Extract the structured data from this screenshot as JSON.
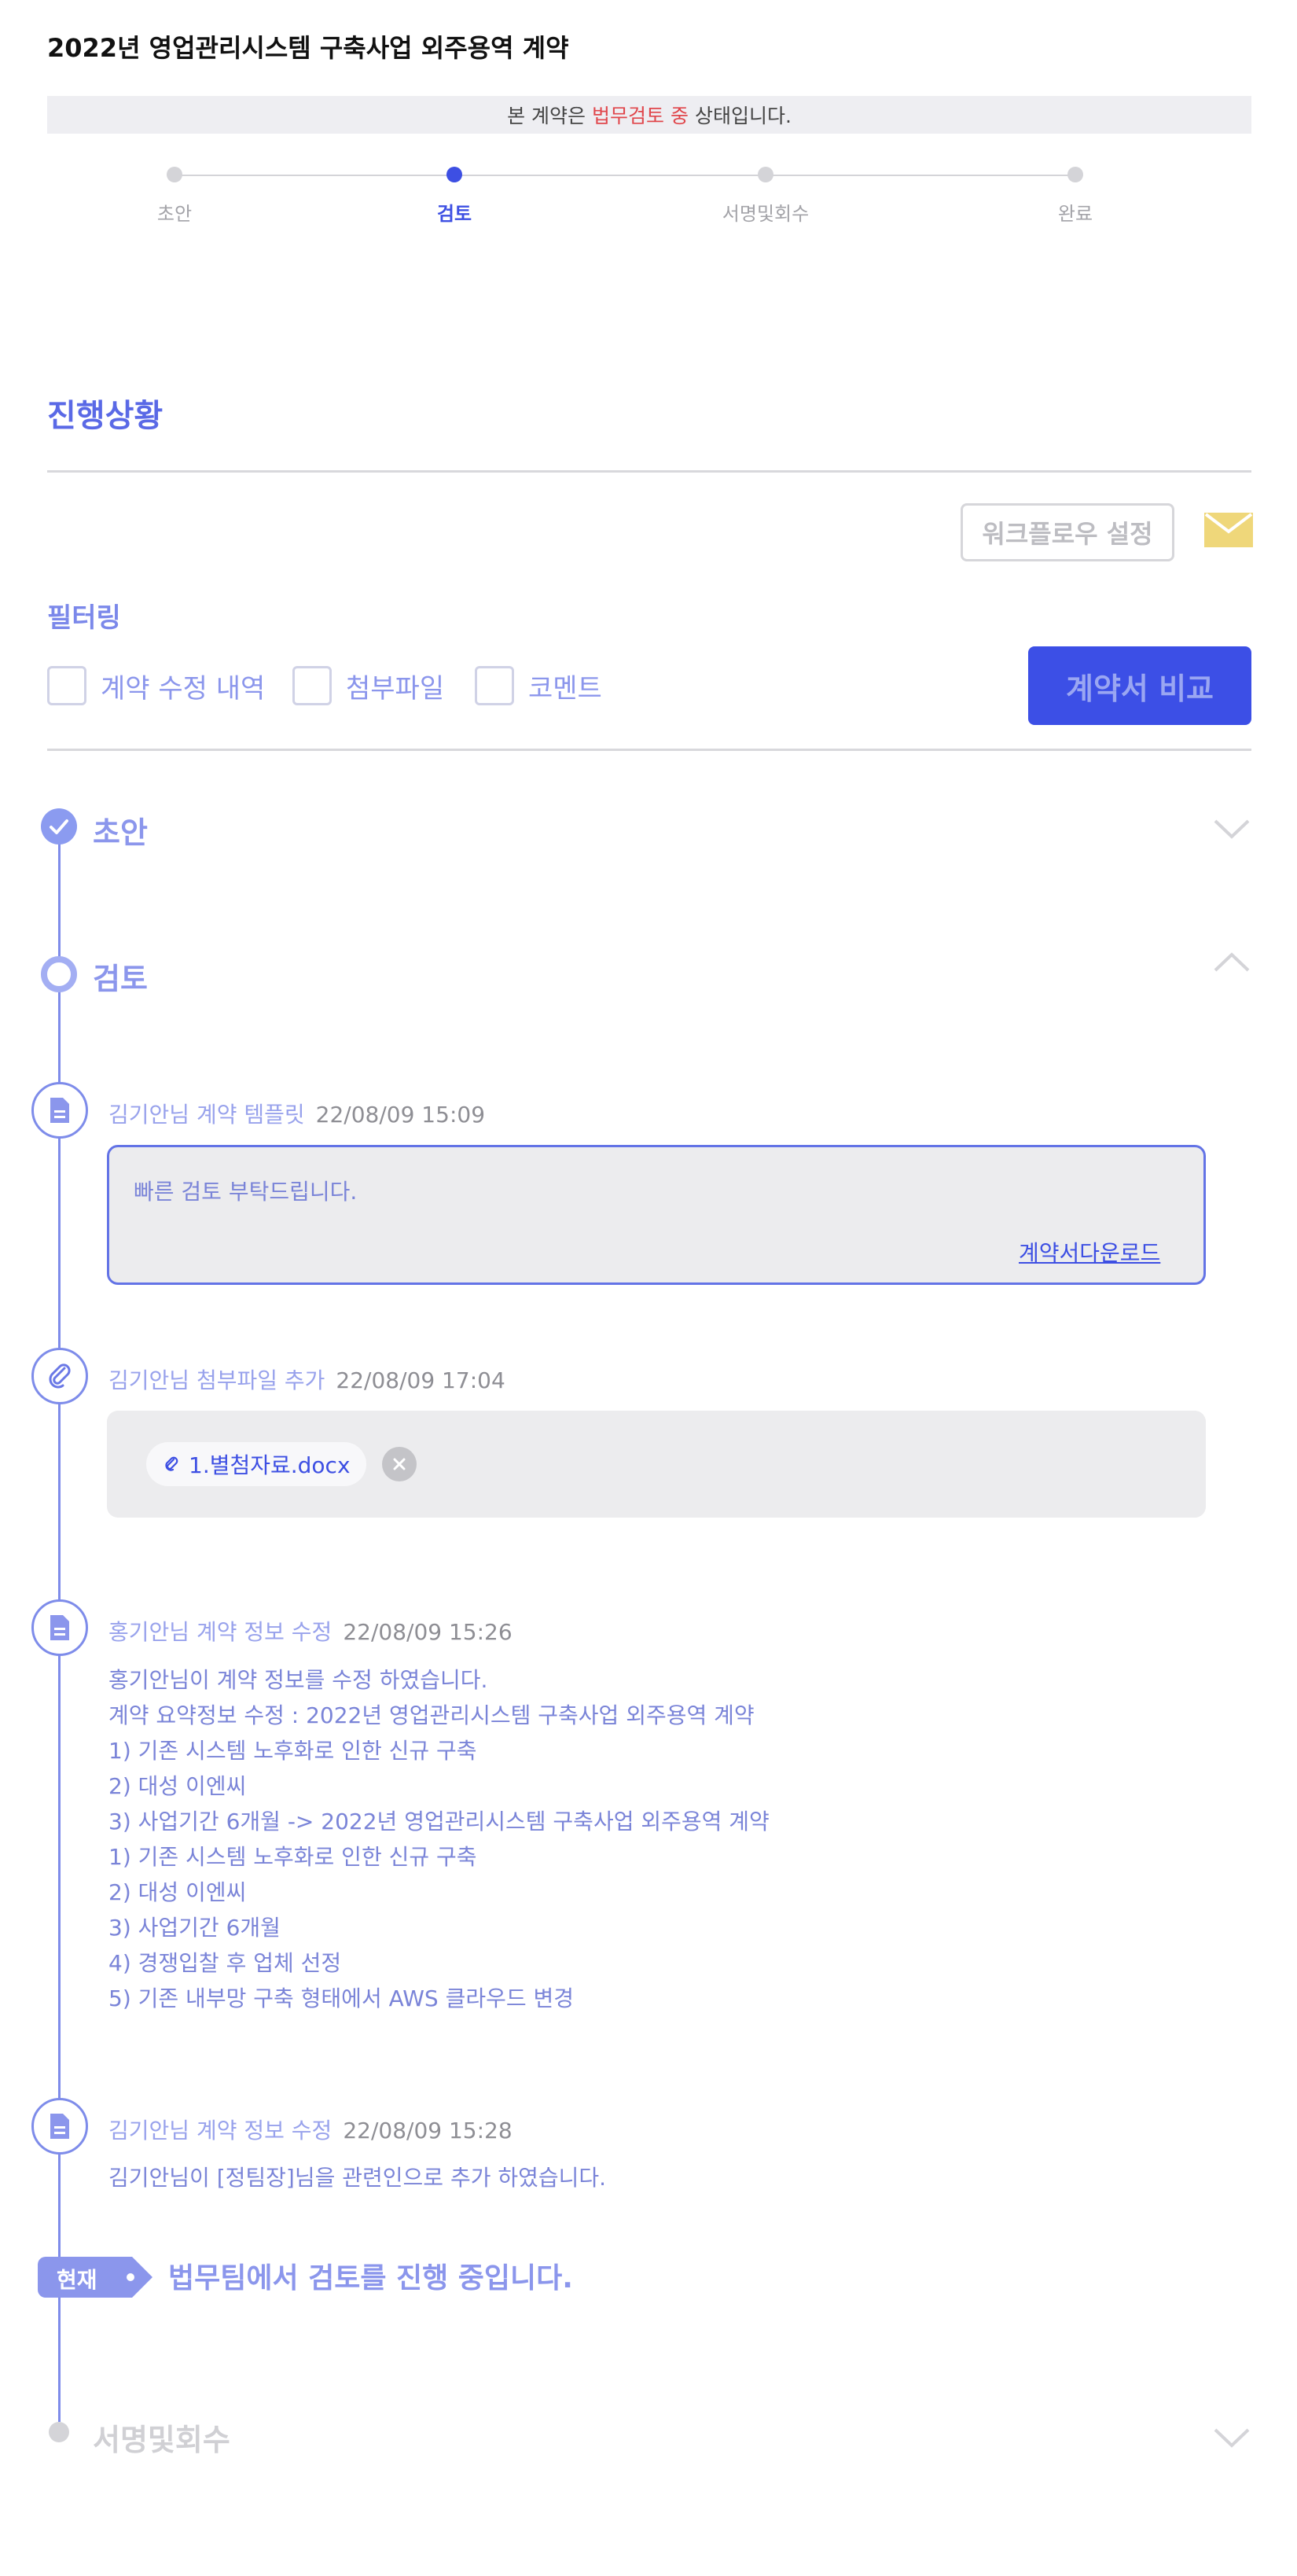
{
  "header": {
    "title": "2022년 영업관리시스템 구축사업 외주용역 계약",
    "status_prefix": "본 계약은",
    "status_highlight": "법무검토 중",
    "status_suffix": "상태입니다."
  },
  "stepper": {
    "steps": [
      "초안",
      "검토",
      "서명및회수",
      "완료"
    ],
    "active_index": 1
  },
  "progress": {
    "title": "진행상황",
    "workflow_button": "워크플로우 설정",
    "filter_label": "필터링",
    "filters": [
      "계약 수정 내역",
      "첨부파일",
      "코멘트"
    ],
    "compare_button": "계약서 비교"
  },
  "timeline": {
    "phases": [
      "초안",
      "검토",
      "서명및회수"
    ],
    "events": [
      {
        "who": "김기안님 계약 템플릿",
        "when": "22/08/09 15:09",
        "comment": "빠른 검토 부탁드립니다.",
        "link": "계약서다운로드"
      },
      {
        "who": "김기안님 첨부파일 추가",
        "when": "22/08/09 17:04",
        "file": "1.별첨자료.docx"
      },
      {
        "who": "홍기안님 계약 정보 수정",
        "when": "22/08/09 15:26",
        "lines": [
          "홍기안님이 계약 정보를 수정 하였습니다.",
          "계약 요약정보 수정 : 2022년 영업관리시스템 구축사업 외주용역 계약",
          "1) 기존 시스템 노후화로 인한 신규 구축",
          "2) 대성 이엔씨",
          "3) 사업기간 6개월 -> 2022년 영업관리시스템 구축사업 외주용역 계약",
          "1) 기존 시스템 노후화로 인한 신규 구축",
          "2) 대성 이엔씨",
          "3) 사업기간 6개월",
          "4) 경쟁입찰 후 업체 선정",
          "5) 기존 내부망 구축 형태에서 AWS 클라우드 변경"
        ]
      },
      {
        "who": "김기안님 계약 정보 수정",
        "when": "22/08/09 15:28",
        "text": "김기안님이 [정팀장]님을 관련인으로 추가 하였습니다."
      }
    ],
    "current_tag": "현재",
    "current_message": "법무팀에서 검토를 진행 중입니다."
  },
  "colors": {
    "accent": "#3d4fe3",
    "accent_light": "#8b96ec",
    "status_red": "#e0464b",
    "mail_yellow": "#efd77a"
  }
}
